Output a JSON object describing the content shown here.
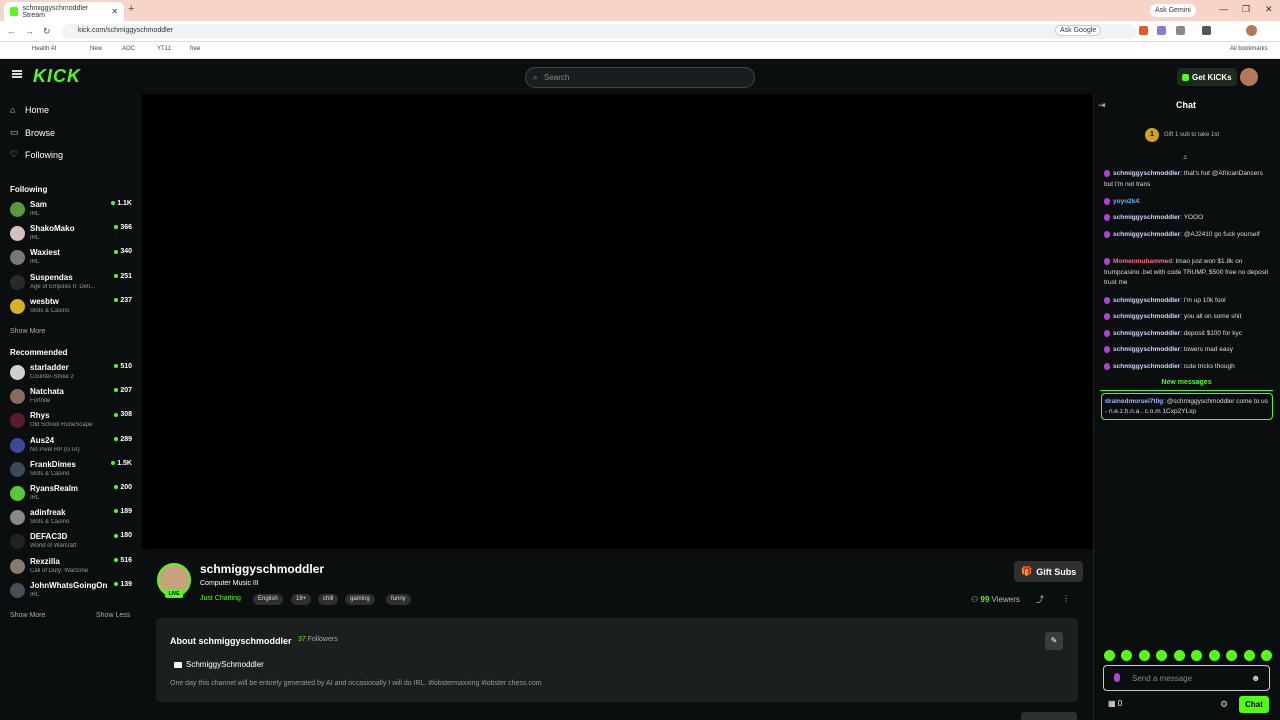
{
  "browser": {
    "tab_title": "schmiggyschmoddler Stream",
    "url": "kick.com/schmiggyschmoddler",
    "ask_gemini": "Ask Gemini",
    "ask_google": "Ask Google",
    "bookmarks": [
      "Health AI",
      "New",
      "AOC",
      "YT11",
      "free"
    ],
    "all_bookmarks": "All bookmarks"
  },
  "kick": {
    "logo": "KICK",
    "search_placeholder": "Search",
    "get_kicks": "Get KICKs"
  },
  "sidebar": {
    "nav": [
      {
        "label": "Home",
        "icon": "home-icon"
      },
      {
        "label": "Browse",
        "icon": "browse-icon"
      },
      {
        "label": "Following",
        "icon": "heart-icon"
      }
    ],
    "following_title": "Following",
    "following": [
      {
        "name": "Sam",
        "game": "IRL",
        "viewers": "1.1K",
        "color": "#5a9a3c"
      },
      {
        "name": "ShakoMako",
        "game": "IRL",
        "viewers": "366",
        "color": "#d8c0c0"
      },
      {
        "name": "Waxiest",
        "game": "IRL",
        "viewers": "340",
        "color": "#777777"
      },
      {
        "name": "Suspendas",
        "game": "Age of Empires II: Defi...",
        "viewers": "251",
        "color": "#2a2a2a"
      },
      {
        "name": "wesbtw",
        "game": "Slots & Casino",
        "viewers": "237",
        "color": "#d8b020"
      }
    ],
    "show_more": "Show More",
    "recommended_title": "Recommended",
    "recommended": [
      {
        "name": "starladder",
        "game": "Counter-Strike 2",
        "viewers": "510",
        "color": "#d0d0d0"
      },
      {
        "name": "Natchata",
        "game": "Fortnite",
        "viewers": "207",
        "color": "#8a6a5a"
      },
      {
        "name": "Rhys",
        "game": "Old School RuneScape",
        "viewers": "308",
        "color": "#5a1a2a"
      },
      {
        "name": "Aus24",
        "game": "No Pixel RP (GTA)",
        "viewers": "289",
        "color": "#3a4a9a"
      },
      {
        "name": "FrankDimes",
        "game": "Slots & Casino",
        "viewers": "1.5K",
        "color": "#3a4a5a"
      },
      {
        "name": "RyansRealm",
        "game": "IRL",
        "viewers": "200",
        "color": "#5ac83a"
      },
      {
        "name": "adinfreak",
        "game": "Slots & Casino",
        "viewers": "189",
        "color": "#888888"
      },
      {
        "name": "DEFAC3D",
        "game": "World of Warcraft",
        "viewers": "180",
        "color": "#222222"
      },
      {
        "name": "Rexzilla",
        "game": "Call of Duty: Warzone",
        "viewers": "516",
        "color": "#8a7a6a"
      },
      {
        "name": "JohnWhatsGoingOn",
        "game": "IRL",
        "viewers": "139",
        "color": "#4a4a5a"
      }
    ],
    "show_more_2": "Show More",
    "show_less": "Show Less"
  },
  "stream": {
    "name": "schmiggyschmoddler",
    "live": "LIVE",
    "title": "Computer Music III",
    "category": "Just Chatting",
    "tags": [
      "English",
      "18+",
      "chill",
      "gaming",
      "funny"
    ],
    "gift_subs": "Gift Subs",
    "viewers_count": "99",
    "viewers_label": "Viewers"
  },
  "about": {
    "title": "About schmiggyschmoddler",
    "followers_count": "37",
    "followers_label": "Followers",
    "youtube": "SchmiggySchmoddler",
    "description": "One day this channel will be entirely generated by AI and occasionally I will do IRL. #lobstermaxxing #lobster chess.com"
  },
  "chat": {
    "title": "Chat",
    "gift_banner": "Gift 1 sub to take 1st",
    "gift_rank": "1",
    "messages": [
      {
        "user": "schmiggyschmoddler",
        "color": "#c9d6ff",
        "text": "that's hot @AfricanDancers but I'm not trans"
      },
      {
        "user": "yoyo2k4",
        "color": "#6ab4ff",
        "text": ""
      },
      {
        "user": "schmiggyschmoddler",
        "color": "#c9d6ff",
        "text": "YOOO"
      },
      {
        "user": "schmiggyschmoddler",
        "color": "#c9d6ff",
        "text": "@AJ2410 go fuck yourself"
      },
      {
        "user": "Momenmuhammed",
        "color": "#ff6b8a",
        "text": "lmao just won $1.8k on trumpcasino .bet with code TRUMP, $500 free no deposit trust me"
      },
      {
        "user": "schmiggyschmoddler",
        "color": "#c9d6ff",
        "text": "i'm up 10k fool"
      },
      {
        "user": "schmiggyschmoddler",
        "color": "#c9d6ff",
        "text": "you all on some shit"
      },
      {
        "user": "schmiggyschmoddler",
        "color": "#c9d6ff",
        "text": "deposit $100 for kyc"
      },
      {
        "user": "schmiggyschmoddler",
        "color": "#c9d6ff",
        "text": "towers mad easy"
      },
      {
        "user": "schmiggyschmoddler",
        "color": "#c9d6ff",
        "text": "cute tricks though"
      }
    ],
    "new_messages": "New messages",
    "highlight": {
      "user": "drainedmorsel7t0g",
      "text": "@schmiggyschmoddler come to us - n.e.z.h.n.a . c.o.m 1Cxp2YLxp"
    },
    "input_placeholder": "Send a message",
    "points": "0",
    "send_button": "Chat"
  }
}
